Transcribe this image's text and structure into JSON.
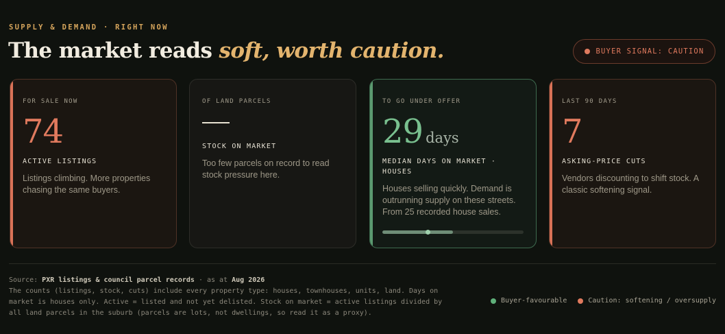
{
  "header": {
    "eyebrow": "SUPPLY & DEMAND · RIGHT NOW",
    "headline_plain": "The market reads ",
    "headline_accent": "soft, worth caution.",
    "signal_label": "BUYER SIGNAL: CAUTION"
  },
  "colors": {
    "caution": "#e07a5e",
    "favourable": "#79c08f",
    "accent_gold": "#e3b46e",
    "background": "#0f120e"
  },
  "cards": [
    {
      "tone": "caution",
      "kicker": "FOR SALE NOW",
      "value": "74",
      "unit": "",
      "metric": "ACTIVE LISTINGS",
      "description": "Listings climbing. More properties chasing the same buyers."
    },
    {
      "tone": "neutral",
      "kicker": "OF LAND PARCELS",
      "value": "—",
      "unit": "",
      "metric": "STOCK ON MARKET",
      "description": "Too few parcels on record to read stock pressure here."
    },
    {
      "tone": "favourable",
      "kicker": "TO GO UNDER OFFER",
      "value": "29",
      "unit": "days",
      "metric": "MEDIAN DAYS ON MARKET · HOUSES",
      "description": "Houses selling quickly. Demand is outrunning supply on these streets. From 25 recorded house sales.",
      "gauge_fraction": 0.5,
      "gauge_marker_fraction": 0.32
    },
    {
      "tone": "caution",
      "kicker": "LAST 90 DAYS",
      "value": "7",
      "unit": "",
      "metric": "ASKING-PRICE CUTS",
      "description": "Vendors discounting to shift stock. A classic softening signal."
    }
  ],
  "footer": {
    "source_prefix": "Source: ",
    "source_name": "PXR listings & council parcel records",
    "source_mid": " · as at ",
    "source_date": "Aug 2026",
    "notes": "The counts (listings, stock, cuts) include every property type: houses, townhouses, units, land. Days on market is houses only. Active = listed and not yet delisted. Stock on market = active listings divided by all land parcels in the suburb (parcels are lots, not dwellings, so read it as a proxy).",
    "legend": [
      {
        "label": "Buyer-favourable",
        "color": "#5fb07a"
      },
      {
        "label": "Caution: softening / oversupply",
        "color": "#e07a5e"
      }
    ]
  }
}
